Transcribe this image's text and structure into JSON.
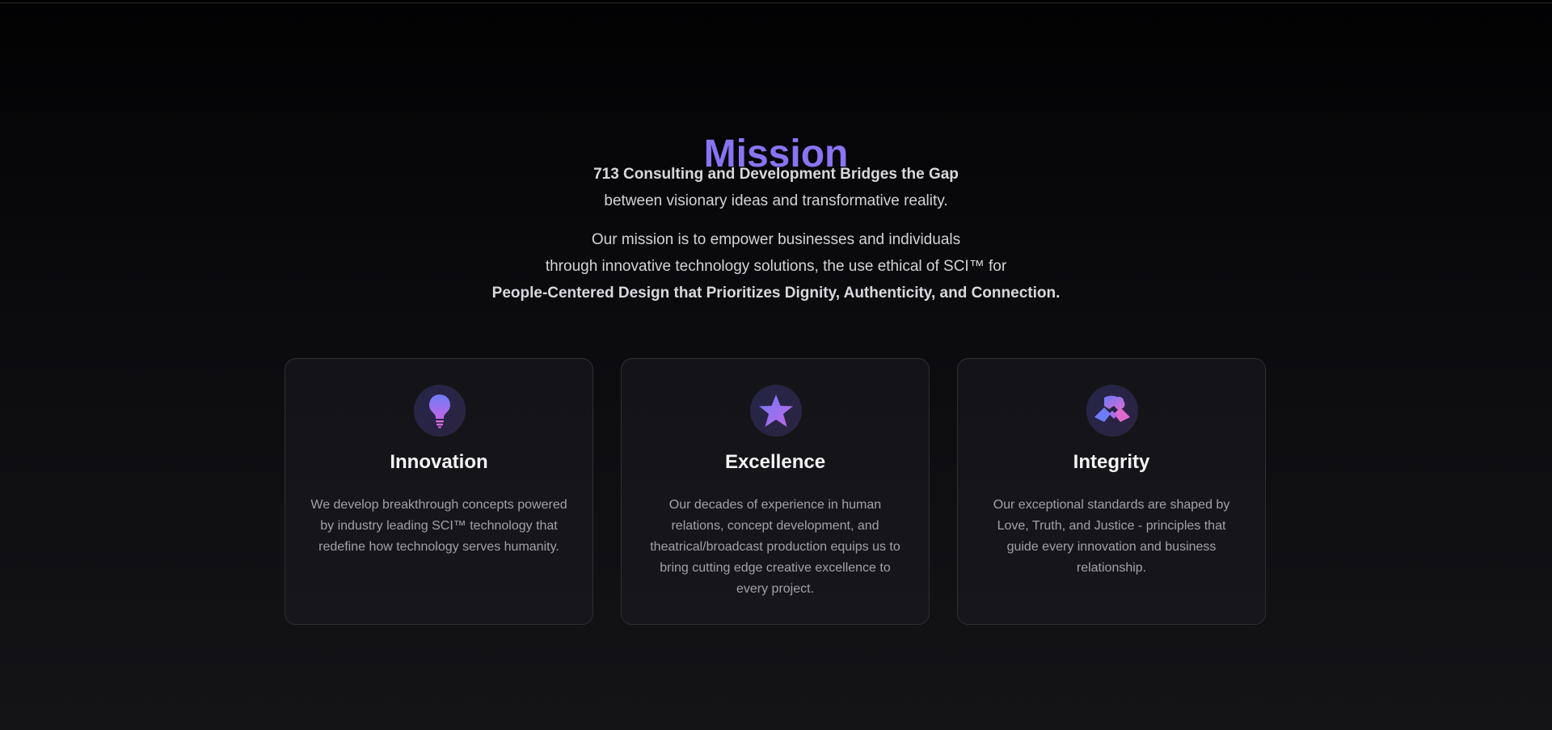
{
  "mission": {
    "title": "Mission",
    "lead_bold": "713 Consulting and Development Bridges the Gap",
    "lead_text": "between visionary ideas and transformative reality.",
    "statement_line1": "Our mission is to empower businesses and individuals",
    "statement_line2": "through innovative technology solutions, the use ethical of SCI™ for",
    "statement_bold": "People-Centered Design that Prioritizes Dignity, Authenticity, and Connection."
  },
  "cards": [
    {
      "icon": "lightbulb-icon",
      "title": "Innovation",
      "text": "We develop breakthrough concepts powered by industry leading SCI™ technology that redefine how technology serves humanity."
    },
    {
      "icon": "star-icon",
      "title": "Excellence",
      "text": "Our decades of experience in human relations, concept development, and theatrical/broadcast production equips us to bring cutting edge creative excellence to every project."
    },
    {
      "icon": "handshake-icon",
      "title": "Integrity",
      "text": "Our exceptional standards are shaped by Love, Truth, and Justice - principles that guide every innovation and business relationship."
    }
  ],
  "colors": {
    "accent_start": "#7a7cf6",
    "accent_end": "#9b6cf2",
    "icon_pink": "#e06ad0",
    "background": "#0b0b0e"
  }
}
